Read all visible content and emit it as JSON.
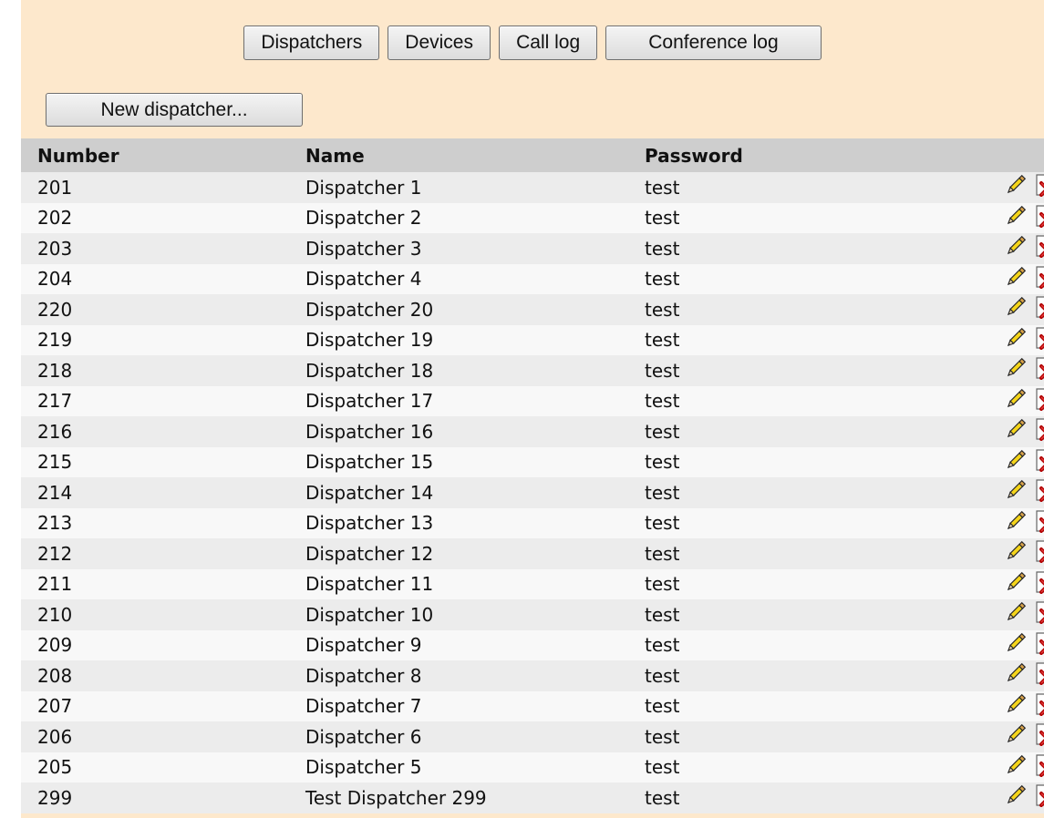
{
  "nav": {
    "dispatchers_label": "Dispatchers",
    "devices_label": "Devices",
    "call_log_label": "Call log",
    "conference_log_label": "Conference log"
  },
  "toolbar": {
    "new_dispatcher_label": "New dispatcher..."
  },
  "table": {
    "columns": [
      "Number",
      "Name",
      "Password"
    ],
    "rows": [
      {
        "number": "201",
        "name": "Dispatcher 1",
        "password": "test"
      },
      {
        "number": "202",
        "name": "Dispatcher 2",
        "password": "test"
      },
      {
        "number": "203",
        "name": "Dispatcher 3",
        "password": "test"
      },
      {
        "number": "204",
        "name": "Dispatcher 4",
        "password": "test"
      },
      {
        "number": "220",
        "name": "Dispatcher 20",
        "password": "test"
      },
      {
        "number": "219",
        "name": "Dispatcher 19",
        "password": "test"
      },
      {
        "number": "218",
        "name": "Dispatcher 18",
        "password": "test"
      },
      {
        "number": "217",
        "name": "Dispatcher 17",
        "password": "test"
      },
      {
        "number": "216",
        "name": "Dispatcher 16",
        "password": "test"
      },
      {
        "number": "215",
        "name": "Dispatcher 15",
        "password": "test"
      },
      {
        "number": "214",
        "name": "Dispatcher 14",
        "password": "test"
      },
      {
        "number": "213",
        "name": "Dispatcher 13",
        "password": "test"
      },
      {
        "number": "212",
        "name": "Dispatcher 12",
        "password": "test"
      },
      {
        "number": "211",
        "name": "Dispatcher 11",
        "password": "test"
      },
      {
        "number": "210",
        "name": "Dispatcher 10",
        "password": "test"
      },
      {
        "number": "209",
        "name": "Dispatcher 9",
        "password": "test"
      },
      {
        "number": "208",
        "name": "Dispatcher 8",
        "password": "test"
      },
      {
        "number": "207",
        "name": "Dispatcher 7",
        "password": "test"
      },
      {
        "number": "206",
        "name": "Dispatcher 6",
        "password": "test"
      },
      {
        "number": "205",
        "name": "Dispatcher 5",
        "password": "test"
      },
      {
        "number": "299",
        "name": "Test Dispatcher 299",
        "password": "test"
      }
    ],
    "row_icons": [
      "pencil-icon",
      "delete-icon"
    ]
  },
  "colors": {
    "panel_background": "#fde8cc",
    "header_background": "#cecece",
    "row_odd": "#ececec",
    "row_even": "#f8f8f8"
  }
}
